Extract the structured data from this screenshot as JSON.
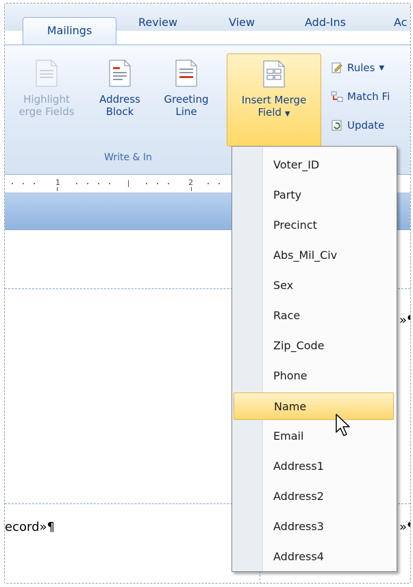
{
  "tabs": [
    "Mailings",
    "Review",
    "View",
    "Add-Ins",
    "Ac"
  ],
  "ribbon": {
    "highlight": [
      "Highlight",
      "erge Fields"
    ],
    "address": [
      "Address",
      "Block"
    ],
    "greeting": [
      "Greeting",
      "Line"
    ],
    "insert": [
      "Insert Merge",
      "Field"
    ],
    "rules": "Rules",
    "match": "Match Fi",
    "update": "Update",
    "group_label": "Write & In"
  },
  "ruler": [
    "1",
    "2"
  ],
  "document": {
    "left_text": "ecord»¶",
    "right_text_1": "»¶",
    "right_text_2": "»¶"
  },
  "merge_menu": {
    "items": [
      "Voter_ID",
      "Party",
      "Precinct",
      "Abs_Mil_Civ",
      "Sex",
      "Race",
      "Zip_Code",
      "Phone",
      "Name",
      "Email",
      "Address1",
      "Address2",
      "Address3",
      "Address4"
    ],
    "selected": "Name"
  },
  "colors": {
    "ribbon_text": "#15428b",
    "highlight": "#fdd86f",
    "ribbon_border": "#8db2e3"
  }
}
